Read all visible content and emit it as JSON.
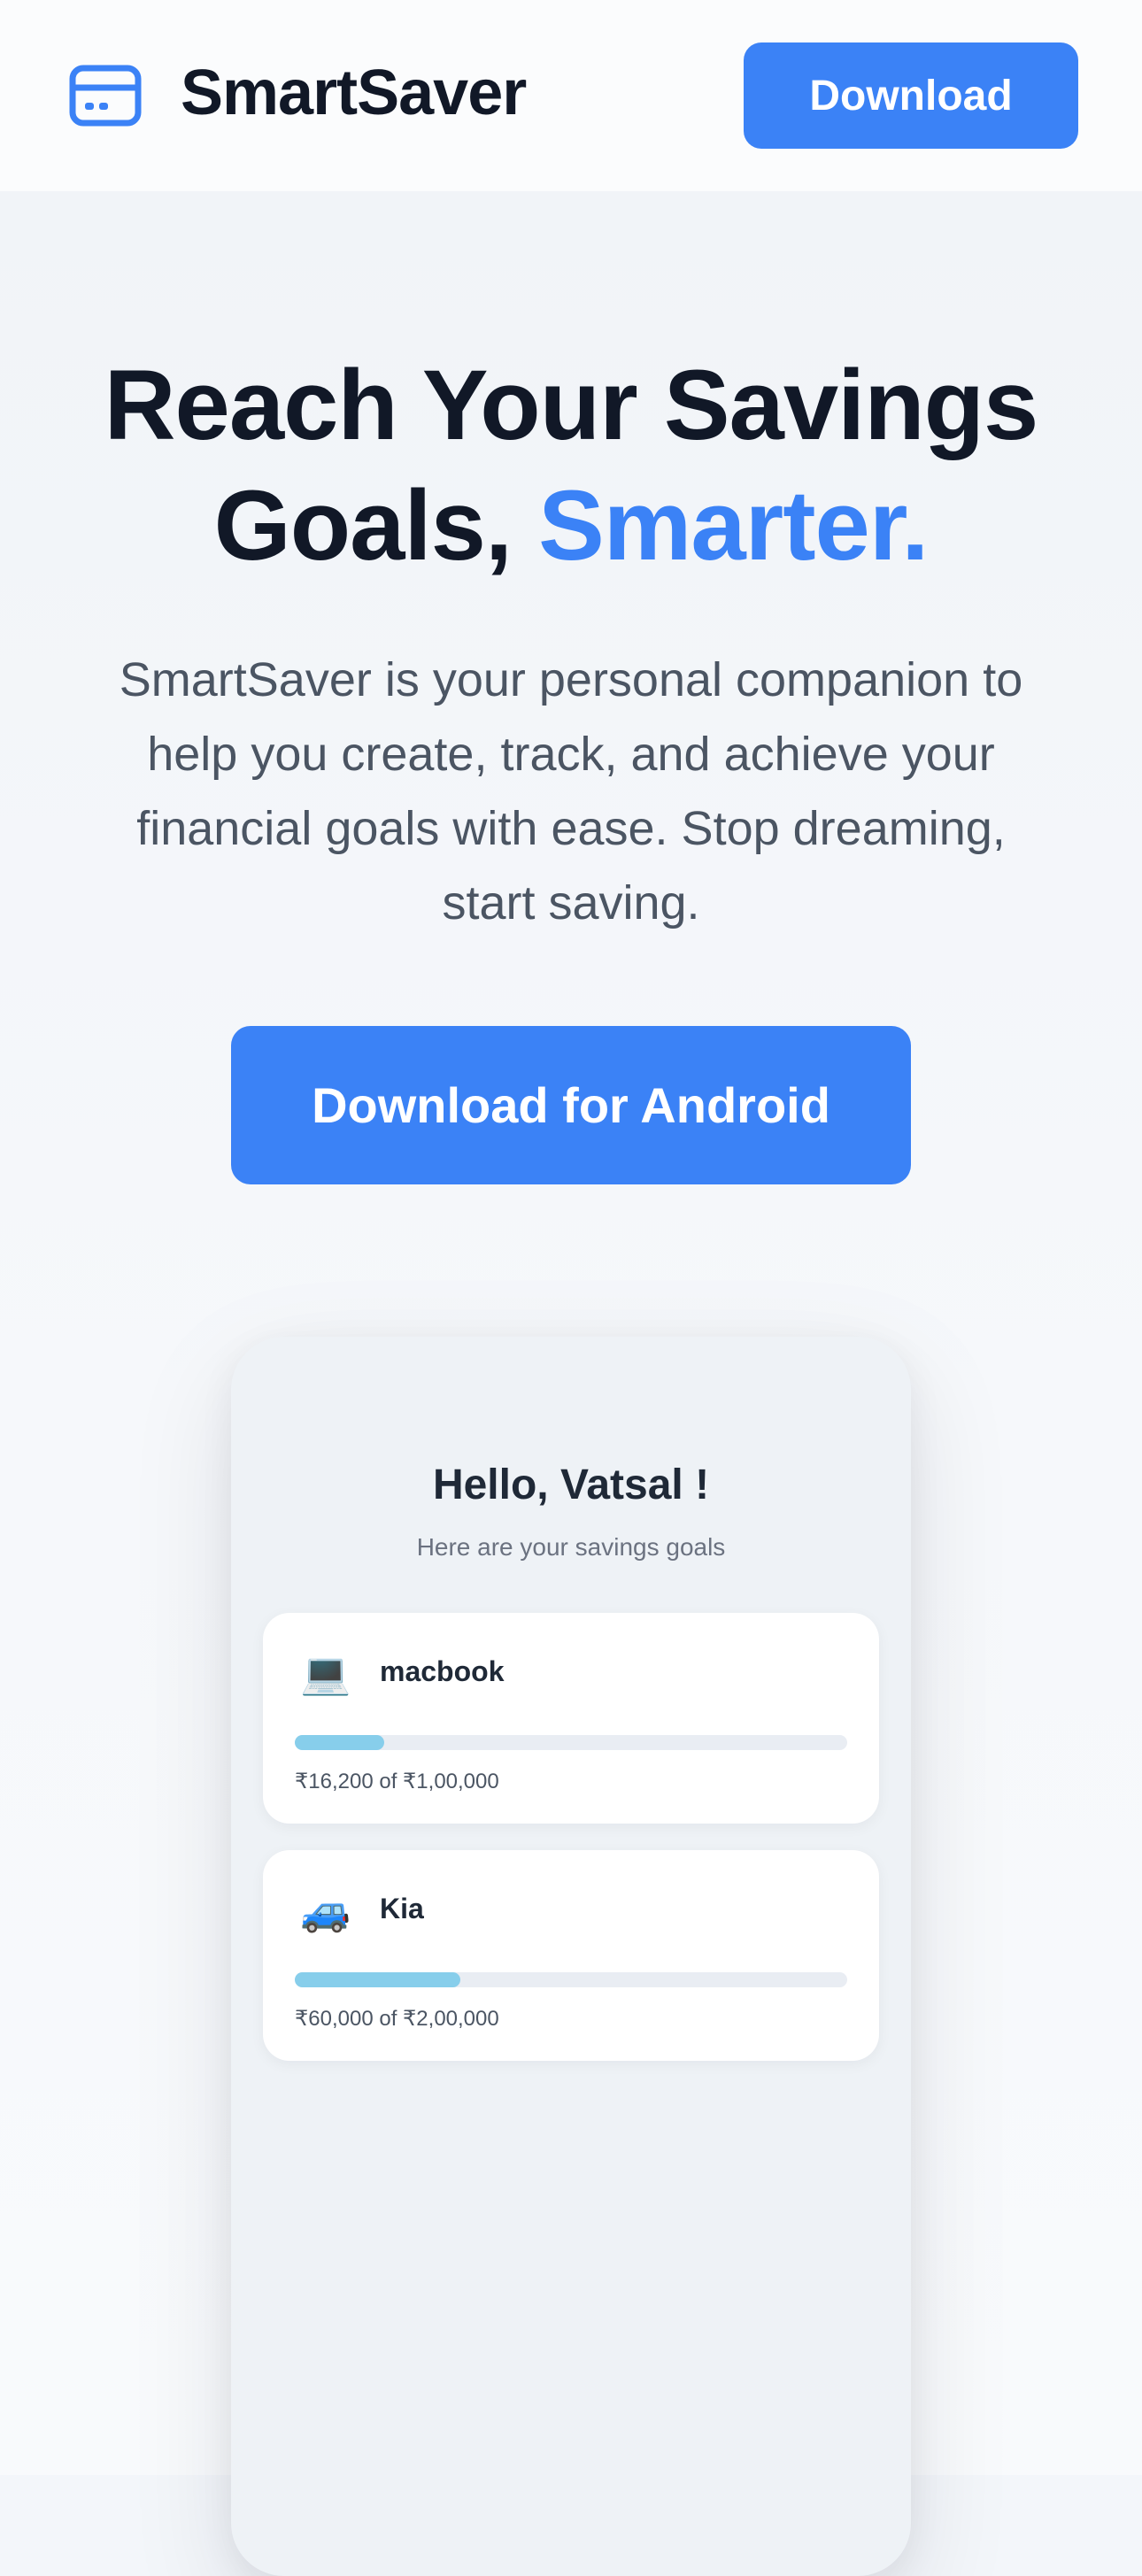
{
  "header": {
    "brand": "SmartSaver",
    "download_label": "Download"
  },
  "hero": {
    "title_line1": "Reach Your Savings",
    "title_line2_prefix": "Goals, ",
    "title_line2_accent": "Smarter.",
    "subtitle": "SmartSaver is your personal companion to help you create, track, and achieve your financial goals with ease. Stop dreaming, start saving.",
    "cta_label": "Download for Android"
  },
  "phone": {
    "greeting": "Hello, Vatsal !",
    "greeting_sub": "Here are your savings goals",
    "goals": [
      {
        "icon": "laptop-icon",
        "emoji": "💻",
        "name": "macbook",
        "progress": 0.162,
        "amount": "₹16,200 of ₹1,00,000"
      },
      {
        "icon": "car-icon",
        "emoji": "🚙",
        "name": "Kia",
        "progress": 0.3,
        "amount": "₹60,000 of ₹2,00,000"
      }
    ]
  },
  "colors": {
    "accent": "#3b82f6",
    "progress": "#87ceeb",
    "heading": "#111827"
  }
}
